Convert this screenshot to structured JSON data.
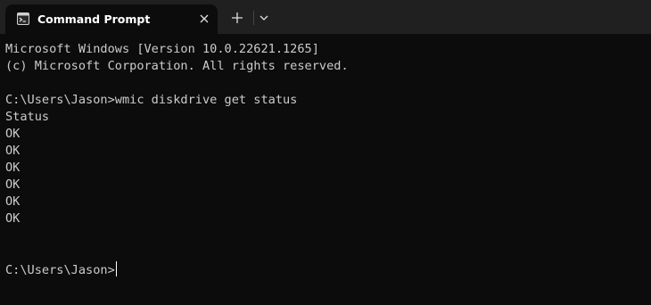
{
  "tab": {
    "title": "Command Prompt",
    "icon": "cmd-icon"
  },
  "tabbar": {
    "new_tab_icon": "plus-icon",
    "dropdown_icon": "chevron-down-icon",
    "close_icon": "close-icon"
  },
  "console": {
    "lines": [
      "Microsoft Windows [Version 10.0.22621.1265]",
      "(c) Microsoft Corporation. All rights reserved.",
      "",
      "C:\\Users\\Jason>wmic diskdrive get status",
      "Status",
      "OK",
      "OK",
      "OK",
      "OK",
      "OK",
      "OK",
      "",
      ""
    ],
    "prompt": "C:\\Users\\Jason>"
  },
  "colors": {
    "background": "#0c0c0c",
    "tabbar": "#202020",
    "text": "#cccccc",
    "title": "#ffffff"
  }
}
